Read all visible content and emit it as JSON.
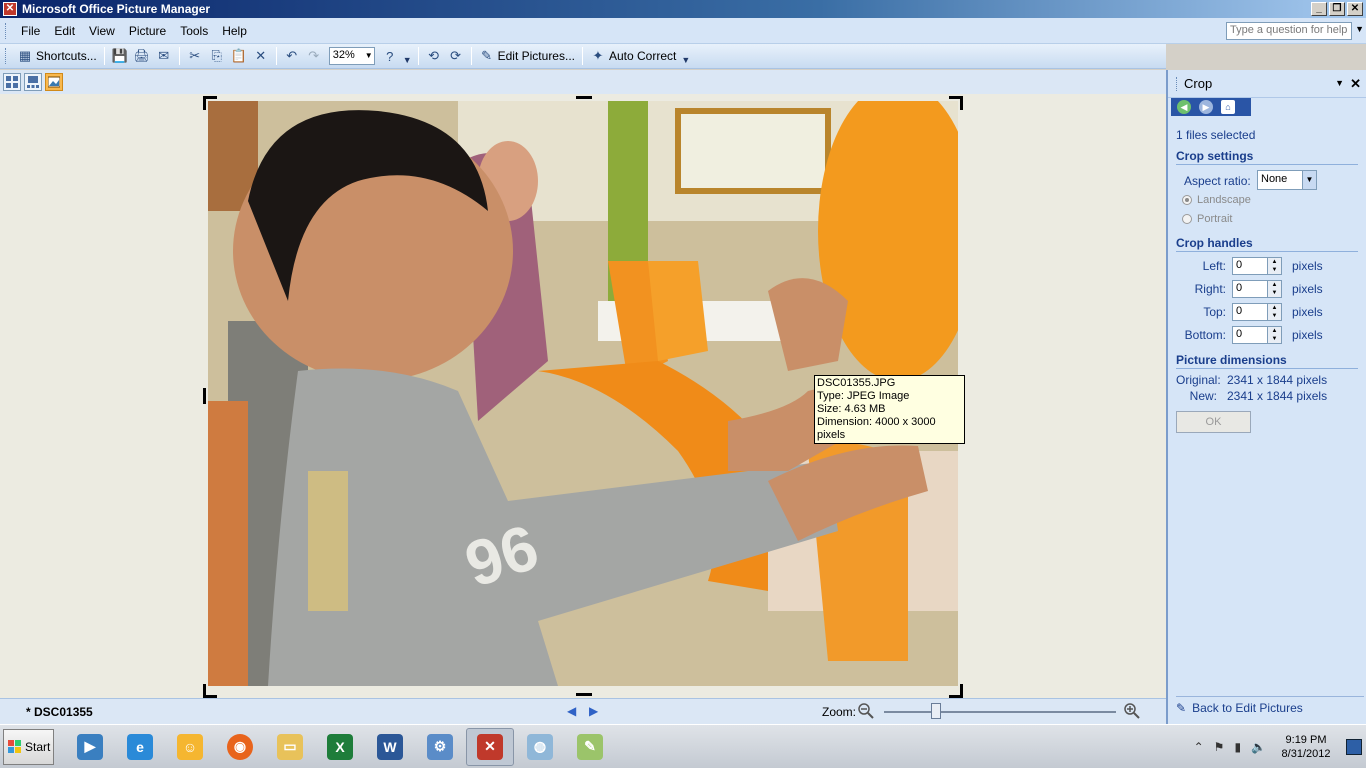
{
  "window": {
    "title": "Microsoft Office Picture Manager"
  },
  "menu": {
    "items": [
      "File",
      "Edit",
      "View",
      "Picture",
      "Tools",
      "Help"
    ],
    "help_placeholder": "Type a question for help"
  },
  "toolbar": {
    "shortcuts_label": "Shortcuts...",
    "zoom_value": "32%",
    "edit_pictures_label": "Edit Pictures...",
    "auto_correct_label": "Auto Correct"
  },
  "tooltip": {
    "line1": "DSC01355.JPG",
    "line2": "Type: JPEG Image",
    "line3": "Size: 4.63 MB",
    "line4": "Dimension: 4000 x 3000 pixels"
  },
  "status": {
    "filename": "* DSC01355",
    "zoom_label": "Zoom:",
    "zoom_level": 0.23
  },
  "taskpane": {
    "title": "Crop",
    "files_selected": "1 files selected",
    "crop_settings_heading": "Crop settings",
    "aspect_ratio_label": "Aspect ratio:",
    "aspect_ratio_value": "None",
    "landscape_label": "Landscape",
    "portrait_label": "Portrait",
    "crop_handles_heading": "Crop handles",
    "handles": [
      {
        "label": "Left:",
        "value": "0",
        "unit": "pixels"
      },
      {
        "label": "Right:",
        "value": "0",
        "unit": "pixels"
      },
      {
        "label": "Top:",
        "value": "0",
        "unit": "pixels"
      },
      {
        "label": "Bottom:",
        "value": "0",
        "unit": "pixels"
      }
    ],
    "dimensions_heading": "Picture dimensions",
    "original_label": "Original:",
    "original_value": "2341 x 1844 pixels",
    "new_label": "New:",
    "new_value": "2341 x 1844 pixels",
    "ok_label": "OK",
    "back_link": "Back to Edit Pictures"
  },
  "taskbar": {
    "start_label": "Start",
    "clock_time": "9:19 PM",
    "clock_date": "8/31/2012"
  },
  "colors": {
    "titlebar": "#0a246a",
    "pane_bg": "#d6e5f7",
    "accent": "#f9b84d"
  }
}
